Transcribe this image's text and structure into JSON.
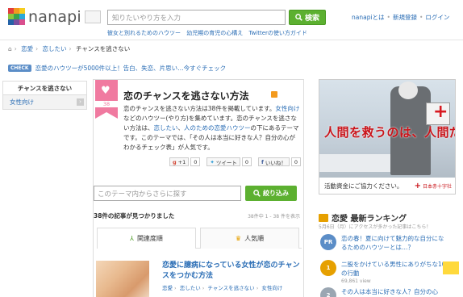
{
  "header": {
    "logo_text": "nanapi",
    "search_placeholder": "知りたいやり方を入力",
    "search_button": "検索",
    "sub_links": [
      "彼女と別れるためのハウツー",
      "幼児期の育児の心構え",
      "Twitterの使い方ガイド"
    ],
    "nav": [
      "nanapiとは",
      "新規登録",
      "ログイン"
    ]
  },
  "breadcrumb": [
    "恋愛",
    "恋したい",
    "チャンスを逃さない"
  ],
  "promo": {
    "badge": "CHECK",
    "text": "恋愛のハウツーが5000件以上！告白、失恋、片思い…今すぐチェック"
  },
  "sidebar": {
    "head": "チャンスを逃さない",
    "items": [
      {
        "label": "女性向け"
      }
    ]
  },
  "theme": {
    "ribbon_count": "38",
    "title": "恋のチャンスを逃さない方法",
    "desc_1": "恋のチャンスを逃さない方法は38件を掲載しています。",
    "desc_link_1": "女性向け",
    "desc_2": "などのハウツー(やり方)を集めています。恋のチャンスを逃さない方法は、",
    "desc_link_2": "恋したい",
    "desc_3": "、",
    "desc_link_3": "人のための恋愛ハウツー",
    "desc_4": "の下にあるテーマです。このテーマでは、「その人は本当に好きな人？自分の心がわかるチェック表」が人気です。"
  },
  "social": {
    "google_label": "+1",
    "google_count": "0",
    "tweet_label": "ツイート",
    "tweet_count": "0",
    "fb_label": "いいね！",
    "fb_count": "0"
  },
  "inner_search": {
    "placeholder": "このテーマ内からさらに探す",
    "button": "絞り込み"
  },
  "results": {
    "found": "38件の記事が見つかりました",
    "range": "38件中 1 - 38 件を表示"
  },
  "tabs": [
    {
      "label": "関連度順"
    },
    {
      "label": "人気順"
    }
  ],
  "article": {
    "title": "恋愛に臆病になっている女性が恋のチャンスをつかむ方法",
    "tags": [
      "恋愛",
      "恋したい",
      "チャンスを逃さない",
      "女性向け"
    ]
  },
  "ad": {
    "copy": "人間を救うのは、人間だ。",
    "foot_left": "活動資金にご協力ください。",
    "foot_right": "日本赤十字社"
  },
  "ranking": {
    "title": "恋愛 最新ランキング",
    "subtitle": "5月6日（月）にアクセスが多かった記事はこちら！",
    "items": [
      {
        "badge": "PR",
        "text": "恋の春！夏に向けて魅力的な自分になるためのハウツーとは…？",
        "views": ""
      },
      {
        "badge": "1",
        "text": "二股をかけている男性にありがちな10の行動",
        "views": "69,861 view"
      },
      {
        "badge": "2",
        "text": "その人は本当に好きな人？自分の心",
        "views": ""
      }
    ]
  },
  "colors": {
    "brand_green": "#5cb030",
    "link_blue": "#2a6db5",
    "ribbon_pink": "#f07aa0",
    "ad_red": "#c9141a"
  }
}
